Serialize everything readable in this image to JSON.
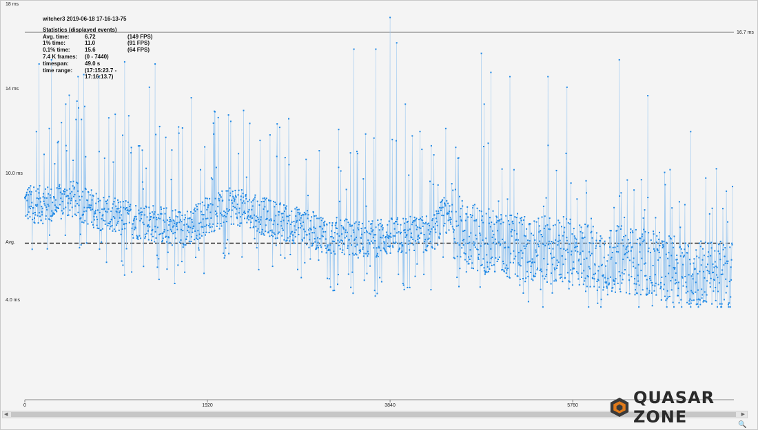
{
  "stats": {
    "title": "witcher3 2019-06-18 17-16-13-75",
    "header": "Statistics (displayed events)",
    "rows": [
      {
        "label": "Avg. time:",
        "value": "6.72",
        "extra": "(149 FPS)"
      },
      {
        "label": "1% time:",
        "value": "11.0",
        "extra": "(91 FPS)"
      },
      {
        "label": "0.1% time:",
        "value": "15.6",
        "extra": "(64 FPS)"
      },
      {
        "label": "7.4 K frames:",
        "value": "(0 - 7440)",
        "extra": ""
      },
      {
        "label": "timespan:",
        "value": "49.0 s",
        "extra": ""
      },
      {
        "label": "time range:",
        "value": "(17:15:23.7 - 17:16:13.7)",
        "extra": ""
      }
    ]
  },
  "chart_data": {
    "type": "scatter",
    "title": "witcher3 2019-06-18 17-16-13-75",
    "xlabel": "",
    "ylabel": "",
    "x_range": [
      0,
      7440
    ],
    "x_ticks": [
      0,
      1920,
      3840,
      5760
    ],
    "x_tick_labels": [
      "0",
      "1920",
      "3840",
      "5760"
    ],
    "y_ticks": [
      {
        "label": "18 ms",
        "value": 18
      },
      {
        "label": "14 ms",
        "value": 14
      },
      {
        "label": "10.0 ms",
        "value": 10
      },
      {
        "label": "Avg.",
        "value": 6.72
      },
      {
        "label": "4.0 ms",
        "value": 4
      }
    ],
    "reference_lines": [
      {
        "label": "16.7 ms",
        "value": 16.7,
        "style": "solid"
      },
      {
        "label": "Avg.",
        "value": 6.72,
        "style": "dashed"
      }
    ],
    "series": [
      {
        "color": "#1e88e5",
        "line_color": "#9ec9f0",
        "trend": {
          "x": [
            0,
            300,
            500,
            900,
            1300,
            1700,
            1900,
            2200,
            2500,
            2900,
            3200,
            3500,
            3800,
            4000,
            4300,
            4400,
            4600,
            4800,
            5000,
            5500,
            6000,
            6500,
            6800,
            7100,
            7440
          ],
          "y": [
            8.6,
            8.5,
            8.8,
            8.0,
            7.7,
            7.4,
            8.0,
            8.5,
            8.0,
            7.5,
            7.1,
            6.9,
            7.0,
            7.1,
            7.2,
            8.0,
            7.3,
            6.9,
            6.6,
            6.4,
            6.1,
            5.8,
            5.5,
            5.3,
            5.2
          ]
        },
        "spikes": [
          {
            "x": 150,
            "y": 15.2
          },
          {
            "x": 280,
            "y": 15.4
          },
          {
            "x": 430,
            "y": 13.3
          },
          {
            "x": 560,
            "y": 14.6
          },
          {
            "x": 620,
            "y": 14.7
          },
          {
            "x": 780,
            "y": 14.6
          },
          {
            "x": 1050,
            "y": 15.3
          },
          {
            "x": 1370,
            "y": 15.2
          },
          {
            "x": 1310,
            "y": 14.1
          },
          {
            "x": 1750,
            "y": 13.6
          },
          {
            "x": 2300,
            "y": 13.0
          },
          {
            "x": 2680,
            "y": 12.2
          },
          {
            "x": 3300,
            "y": 12.1
          },
          {
            "x": 3460,
            "y": 15.9
          },
          {
            "x": 3690,
            "y": 15.9
          },
          {
            "x": 3840,
            "y": 17.4
          },
          {
            "x": 3910,
            "y": 16.2
          },
          {
            "x": 4000,
            "y": 13.3
          },
          {
            "x": 4800,
            "y": 15.7
          },
          {
            "x": 4830,
            "y": 13.3
          },
          {
            "x": 4900,
            "y": 14.8
          },
          {
            "x": 5100,
            "y": 14.6
          },
          {
            "x": 5500,
            "y": 14.6
          },
          {
            "x": 5700,
            "y": 14.1
          },
          {
            "x": 6250,
            "y": 15.4
          },
          {
            "x": 6550,
            "y": 13.7
          },
          {
            "x": 7000,
            "y": 12.0
          }
        ]
      }
    ]
  },
  "watermark": {
    "text": "QUASAR ZONE"
  },
  "scrollbar": {
    "left_arrow": "◀",
    "right_arrow": "▶"
  }
}
